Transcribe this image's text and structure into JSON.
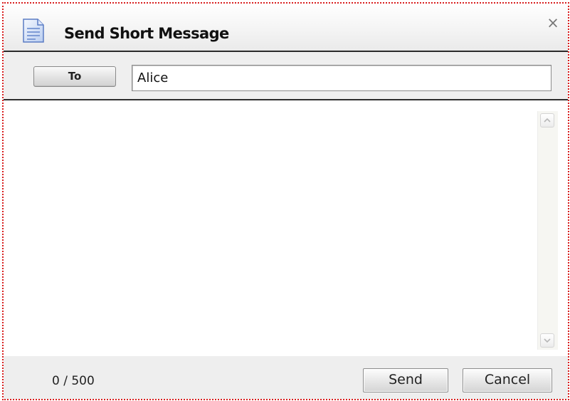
{
  "dialog": {
    "title": "Send Short Message",
    "close_glyph": "×",
    "title_icon": "document-icon"
  },
  "recipient": {
    "to_label": "To",
    "value": "Alice"
  },
  "message": {
    "value": "",
    "scroll_up_icon": "chevron-up-icon",
    "scroll_down_icon": "chevron-down-icon"
  },
  "footer": {
    "char_count": "0 / 500",
    "send_label": "Send",
    "cancel_label": "Cancel"
  },
  "colors": {
    "dialog_border": "#d81e1e",
    "divider": "#2b2b2b",
    "panel_background": "#eeeeee"
  }
}
